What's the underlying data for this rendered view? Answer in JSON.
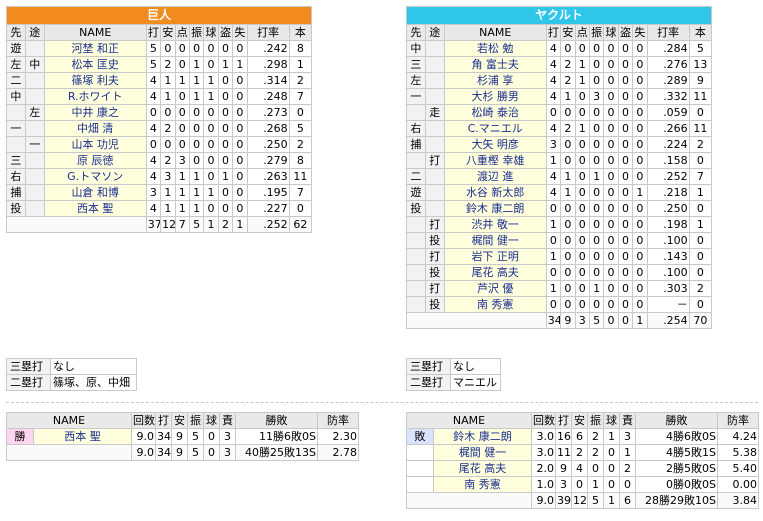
{
  "left_team": {
    "name": "巨人",
    "color": "#f28b1e",
    "headers": [
      "先",
      "途",
      "NAME",
      "打",
      "安",
      "点",
      "振",
      "球",
      "盗",
      "失",
      "打率",
      "本"
    ],
    "batters": [
      [
        "遊",
        "",
        "河埜 和正",
        "5",
        "0",
        "0",
        "0",
        "0",
        "0",
        "0",
        ".242",
        "8"
      ],
      [
        "左",
        "中",
        "松本 匡史",
        "5",
        "2",
        "0",
        "1",
        "0",
        "1",
        "1",
        ".298",
        "1"
      ],
      [
        "二",
        "",
        "篠塚 利夫",
        "4",
        "1",
        "1",
        "1",
        "1",
        "0",
        "0",
        ".314",
        "2"
      ],
      [
        "中",
        "",
        "R.ホワイト",
        "4",
        "1",
        "0",
        "1",
        "1",
        "0",
        "0",
        ".248",
        "7"
      ],
      [
        "",
        "左",
        "中井 康之",
        "0",
        "0",
        "0",
        "0",
        "0",
        "0",
        "0",
        ".273",
        "0"
      ],
      [
        "一",
        "",
        "中畑 清",
        "4",
        "2",
        "0",
        "0",
        "0",
        "0",
        "0",
        ".268",
        "5"
      ],
      [
        "",
        "一",
        "山本 功児",
        "0",
        "0",
        "0",
        "0",
        "0",
        "0",
        "0",
        ".250",
        "2"
      ],
      [
        "三",
        "",
        "原 辰徳",
        "4",
        "2",
        "3",
        "0",
        "0",
        "0",
        "0",
        ".279",
        "8"
      ],
      [
        "右",
        "",
        "G.トマソン",
        "4",
        "3",
        "1",
        "1",
        "0",
        "1",
        "0",
        ".263",
        "11"
      ],
      [
        "捕",
        "",
        "山倉 和博",
        "3",
        "1",
        "1",
        "1",
        "1",
        "0",
        "0",
        ".195",
        "7"
      ],
      [
        "投",
        "",
        "西本 聖",
        "4",
        "1",
        "1",
        "1",
        "0",
        "0",
        "0",
        ".227",
        "0"
      ]
    ],
    "totals": [
      "37",
      "12",
      "7",
      "5",
      "1",
      "2",
      "1",
      ".252",
      "62"
    ],
    "extra": [
      {
        "label": "三塁打",
        "value": "なし"
      },
      {
        "label": "二塁打",
        "value": "篠塚、原、中畑"
      }
    ],
    "pitch_headers": [
      "NAME",
      "回数",
      "打",
      "安",
      "振",
      "球",
      "責",
      "勝敗",
      "防率"
    ],
    "pitchers": [
      {
        "result": "勝",
        "name": "西本 聖",
        "cells": [
          "9.0",
          "34",
          "9",
          "5",
          "0",
          "3",
          "11勝6敗0S",
          "2.30"
        ]
      }
    ],
    "pitch_totals": [
      "9.0",
      "34",
      "9",
      "5",
      "0",
      "3",
      "40勝25敗13S",
      "2.78"
    ]
  },
  "right_team": {
    "name": "ヤクルト",
    "color": "#2fc6ea",
    "headers": [
      "先",
      "途",
      "NAME",
      "打",
      "安",
      "点",
      "振",
      "球",
      "盗",
      "失",
      "打率",
      "本"
    ],
    "batters": [
      [
        "中",
        "",
        "若松 勉",
        "4",
        "0",
        "0",
        "0",
        "0",
        "0",
        "0",
        ".284",
        "5"
      ],
      [
        "三",
        "",
        "角 富士夫",
        "4",
        "2",
        "1",
        "0",
        "0",
        "0",
        "0",
        ".276",
        "13"
      ],
      [
        "左",
        "",
        "杉浦 享",
        "4",
        "2",
        "1",
        "0",
        "0",
        "0",
        "0",
        ".289",
        "9"
      ],
      [
        "一",
        "",
        "大杉 勝男",
        "4",
        "1",
        "0",
        "3",
        "0",
        "0",
        "0",
        ".332",
        "11"
      ],
      [
        "",
        "走",
        "松崎 泰治",
        "0",
        "0",
        "0",
        "0",
        "0",
        "0",
        "0",
        ".059",
        "0"
      ],
      [
        "右",
        "",
        "C.マニエル",
        "4",
        "2",
        "1",
        "0",
        "0",
        "0",
        "0",
        ".266",
        "11"
      ],
      [
        "捕",
        "",
        "大矢 明彦",
        "3",
        "0",
        "0",
        "0",
        "0",
        "0",
        "0",
        ".224",
        "2"
      ],
      [
        "",
        "打",
        "八重樫 幸雄",
        "1",
        "0",
        "0",
        "0",
        "0",
        "0",
        "0",
        ".158",
        "0"
      ],
      [
        "二",
        "",
        "渡辺 進",
        "4",
        "1",
        "0",
        "1",
        "0",
        "0",
        "0",
        ".252",
        "7"
      ],
      [
        "遊",
        "",
        "水谷 新太郎",
        "4",
        "1",
        "0",
        "0",
        "0",
        "0",
        "1",
        ".218",
        "1"
      ],
      [
        "投",
        "",
        "鈴木 康二朗",
        "0",
        "0",
        "0",
        "0",
        "0",
        "0",
        "0",
        ".250",
        "0"
      ],
      [
        "",
        "打",
        "渋井 敬一",
        "1",
        "0",
        "0",
        "0",
        "0",
        "0",
        "0",
        ".198",
        "1"
      ],
      [
        "",
        "投",
        "梶間 健一",
        "0",
        "0",
        "0",
        "0",
        "0",
        "0",
        "0",
        ".100",
        "0"
      ],
      [
        "",
        "打",
        "岩下 正明",
        "1",
        "0",
        "0",
        "0",
        "0",
        "0",
        "0",
        ".143",
        "0"
      ],
      [
        "",
        "投",
        "尾花 高夫",
        "0",
        "0",
        "0",
        "0",
        "0",
        "0",
        "0",
        ".100",
        "0"
      ],
      [
        "",
        "打",
        "芦沢 優",
        "1",
        "0",
        "0",
        "1",
        "0",
        "0",
        "0",
        ".303",
        "2"
      ],
      [
        "",
        "投",
        "南 秀憲",
        "0",
        "0",
        "0",
        "0",
        "0",
        "0",
        "0",
        "－",
        "0"
      ]
    ],
    "totals": [
      "34",
      "9",
      "3",
      "5",
      "0",
      "0",
      "1",
      ".254",
      "70"
    ],
    "extra": [
      {
        "label": "三塁打",
        "value": "なし"
      },
      {
        "label": "二塁打",
        "value": "マニエル"
      }
    ],
    "pitch_headers": [
      "NAME",
      "回数",
      "打",
      "安",
      "振",
      "球",
      "責",
      "勝敗",
      "防率"
    ],
    "pitchers": [
      {
        "result": "敗",
        "name": "鈴木 康二朗",
        "cells": [
          "3.0",
          "16",
          "6",
          "2",
          "1",
          "3",
          "4勝6敗0S",
          "4.24"
        ]
      },
      {
        "result": "",
        "name": "梶間 健一",
        "cells": [
          "3.0",
          "11",
          "2",
          "2",
          "0",
          "1",
          "4勝5敗1S",
          "5.38"
        ]
      },
      {
        "result": "",
        "name": "尾花 高夫",
        "cells": [
          "2.0",
          "9",
          "4",
          "0",
          "0",
          "2",
          "2勝5敗0S",
          "5.40"
        ]
      },
      {
        "result": "",
        "name": "南 秀憲",
        "cells": [
          "1.0",
          "3",
          "0",
          "1",
          "0",
          "0",
          "0勝0敗0S",
          "0.00"
        ]
      }
    ],
    "pitch_totals": [
      "9.0",
      "39",
      "12",
      "5",
      "1",
      "6",
      "28勝29敗10S",
      "3.84"
    ]
  }
}
